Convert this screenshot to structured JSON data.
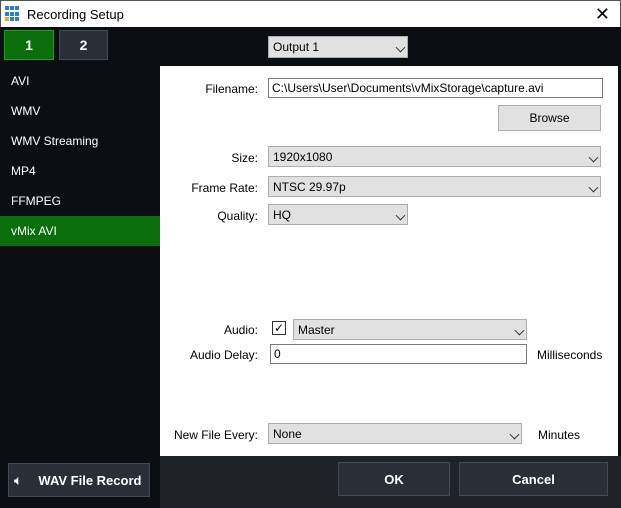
{
  "window": {
    "title": "Recording Setup",
    "close": "✕"
  },
  "tabs": [
    {
      "label": "1",
      "active": true
    },
    {
      "label": "2",
      "active": false
    }
  ],
  "output": {
    "value": "Output 1"
  },
  "sidebar": {
    "items": [
      {
        "label": "AVI"
      },
      {
        "label": "WMV"
      },
      {
        "label": "WMV Streaming"
      },
      {
        "label": "MP4"
      },
      {
        "label": "FFMPEG"
      },
      {
        "label": "vMix AVI",
        "active": true
      }
    ]
  },
  "form": {
    "filename_label": "Filename:",
    "filename": "C:\\Users\\User\\Documents\\vMixStorage\\capture.avi",
    "browse": "Browse",
    "size_label": "Size:",
    "size": "1920x1080",
    "framerate_label": "Frame Rate:",
    "framerate": "NTSC 29.97p",
    "quality_label": "Quality:",
    "quality": "HQ",
    "audio_label": "Audio:",
    "audio_checked": true,
    "audio": "Master",
    "delay_label": "Audio Delay:",
    "delay": "0",
    "delay_unit": "Milliseconds",
    "newfile_label": "New File Every:",
    "newfile": "None",
    "newfile_unit": "Minutes"
  },
  "buttons": {
    "wav": "WAV File Record",
    "ok": "OK",
    "cancel": "Cancel"
  },
  "colors": {
    "accent": "#0a6e0a",
    "background": "#0b0f14"
  }
}
